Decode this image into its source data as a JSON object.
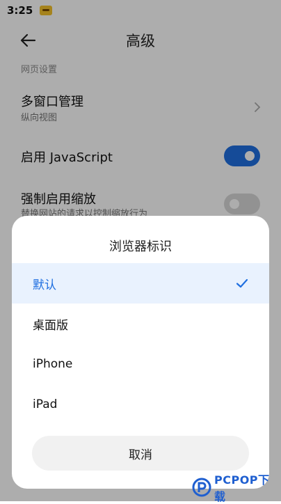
{
  "status_bar": {
    "time": "3:25"
  },
  "header": {
    "title": "高级"
  },
  "settings": {
    "section_label": "网页设置",
    "multiwindow": {
      "title": "多窗口管理",
      "subtitle": "纵向视图"
    },
    "javascript": {
      "title": "启用 JavaScript",
      "enabled": true
    },
    "force_zoom": {
      "title": "强制启用缩放",
      "subtitle": "替换网站的请求以控制缩放行为",
      "enabled": false
    }
  },
  "dialog": {
    "title": "浏览器标识",
    "options": [
      {
        "label": "默认",
        "selected": true
      },
      {
        "label": "桌面版",
        "selected": false
      },
      {
        "label": "iPhone",
        "selected": false
      },
      {
        "label": "iPad",
        "selected": false
      }
    ],
    "cancel_label": "取消"
  },
  "watermark": {
    "text": "PCPOP下载"
  },
  "colors": {
    "accent": "#1f6fe0",
    "selected_bg": "#e9f2fe",
    "scrim": "rgba(0,0,0,0.32)"
  }
}
